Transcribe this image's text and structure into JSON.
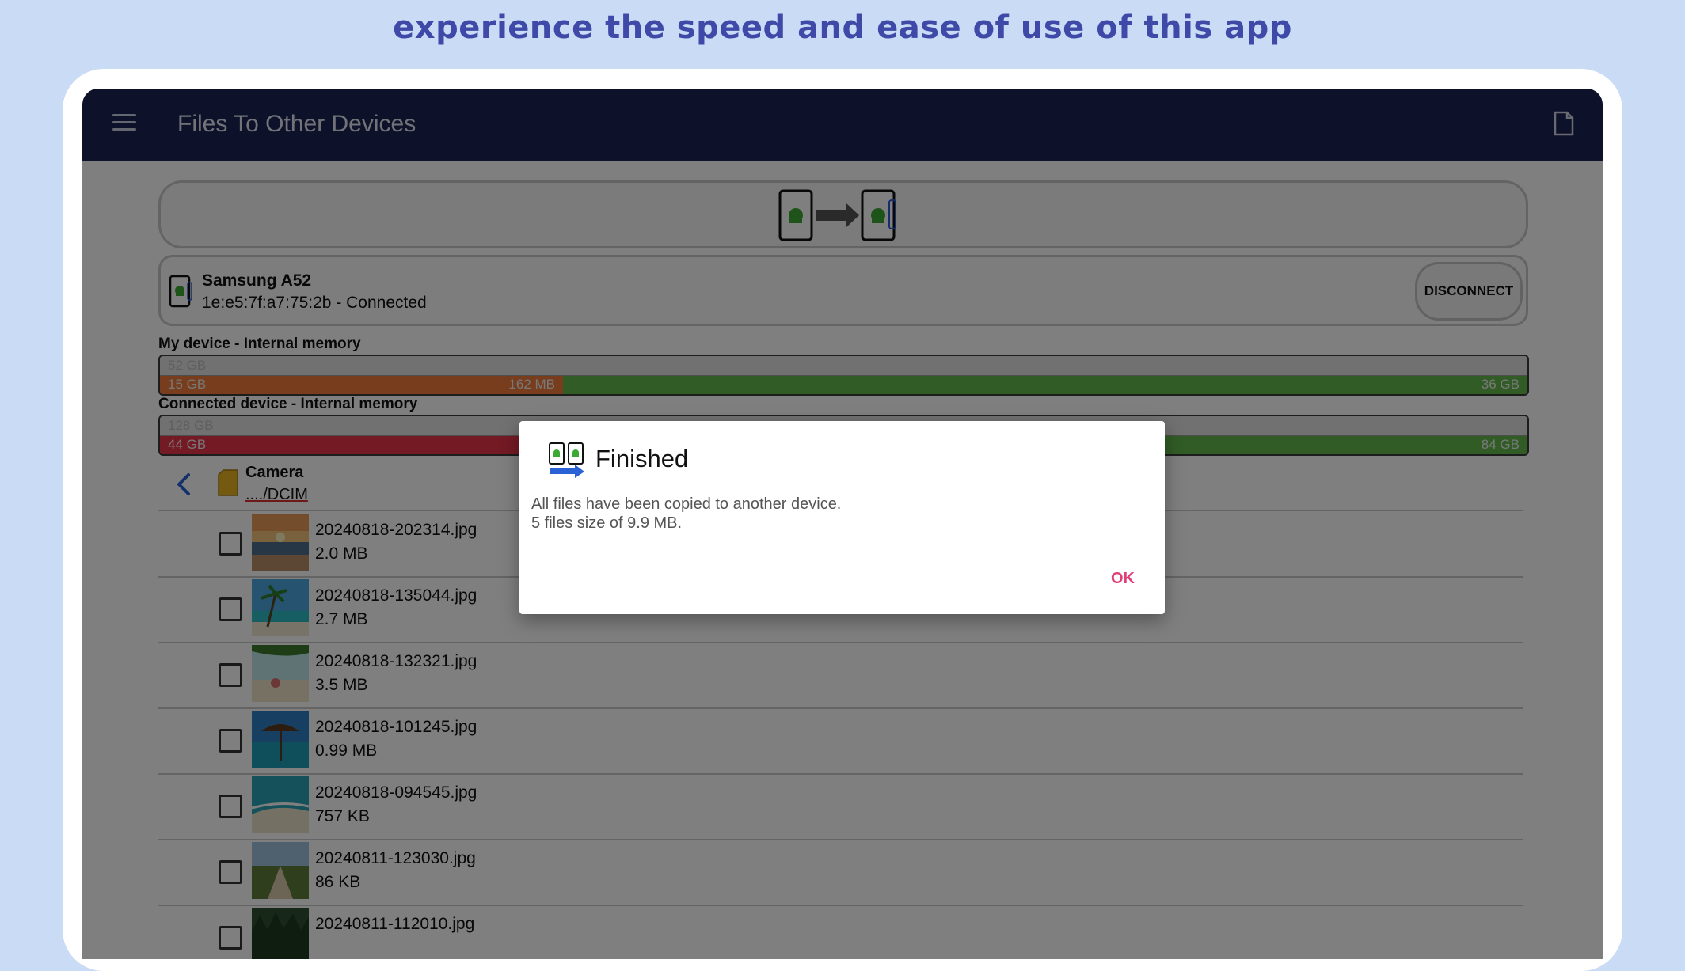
{
  "banner": {
    "text": "experience the speed and ease of use of this app"
  },
  "appbar": {
    "title": "Files To Other Devices",
    "menu_icon": "hamburger-menu-icon",
    "action_icon": "document-icon"
  },
  "colors": {
    "appbar": "#1a2253",
    "accent_ok": "#e0407a",
    "used_orange": "#f07a3a",
    "used_red": "#e8354a",
    "free_green": "#62b94c"
  },
  "device": {
    "name": "Samsung A52",
    "status": "1e:e5:7f:a7:75:2b - Connected",
    "disconnect_label": "DISCONNECT"
  },
  "memory": {
    "my_device": {
      "label": "My device - Internal memory",
      "total": "52 GB",
      "used": "15 GB",
      "transfer": "162 MB",
      "free": "36 GB",
      "used_fraction": 0.29
    },
    "connected_device": {
      "label": "Connected device - Internal memory",
      "total": "128 GB",
      "used": "44 GB",
      "free": "84 GB",
      "used_fraction": 0.34
    }
  },
  "folder": {
    "name": "Camera",
    "path": "..../DCIM"
  },
  "files": [
    {
      "name": "20240818-202314.jpg",
      "size": "2.0 MB"
    },
    {
      "name": "20240818-135044.jpg",
      "size": "2.7 MB"
    },
    {
      "name": "20240818-132321.jpg",
      "size": "3.5 MB"
    },
    {
      "name": "20240818-101245.jpg",
      "size": "0.99 MB"
    },
    {
      "name": "20240818-094545.jpg",
      "size": "757 KB"
    },
    {
      "name": "20240811-123030.jpg",
      "size": "86 KB"
    },
    {
      "name": "20240811-112010.jpg",
      "size": ""
    }
  ],
  "dialog": {
    "title": "Finished",
    "message_line1": "All files have been copied to another device.",
    "message_line2": "5 files size of 9.9 MB.",
    "ok_label": "OK"
  }
}
